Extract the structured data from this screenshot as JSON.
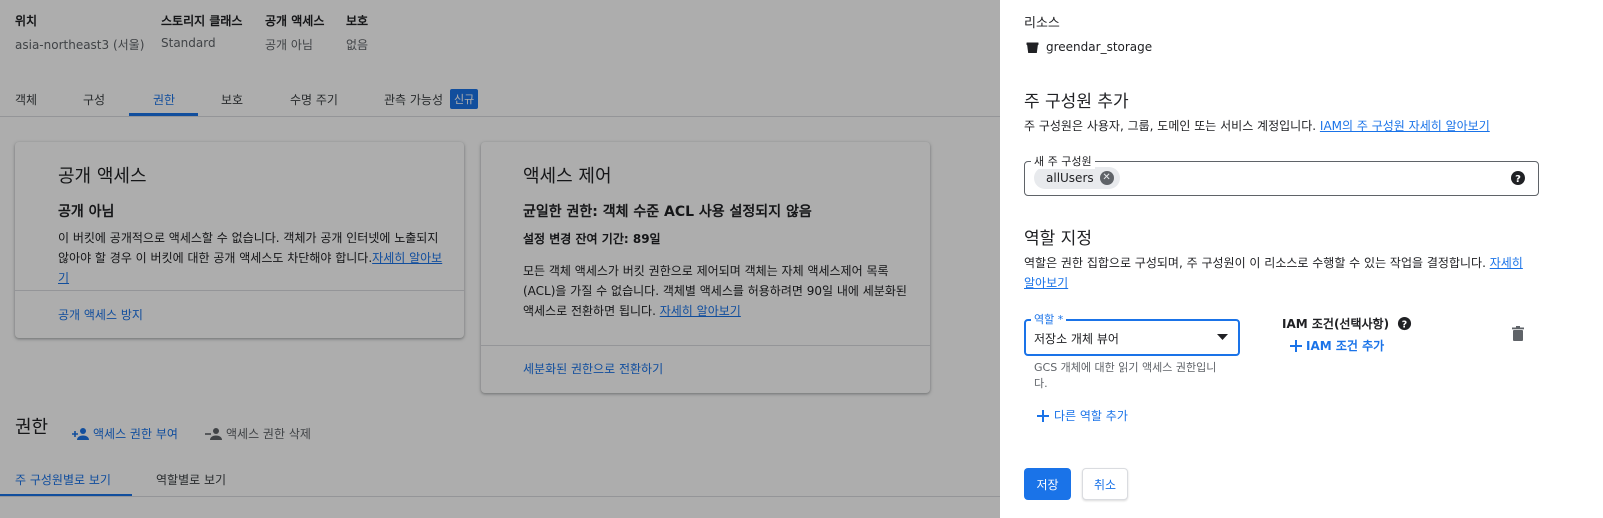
{
  "bucket_info": {
    "location_label": "위치",
    "location_value": "asia-northeast3 (서울)",
    "storage_class_label": "스토리지 클래스",
    "storage_class_value": "Standard",
    "public_access_label": "공개 액세스",
    "public_access_value": "공개 아님",
    "protection_label": "보호",
    "protection_value": "없음"
  },
  "tabs": [
    {
      "label": "객체"
    },
    {
      "label": "구성"
    },
    {
      "label": "권한"
    },
    {
      "label": "보호"
    },
    {
      "label": "수명 주기"
    },
    {
      "label": "관측 가능성",
      "badge": "신규"
    }
  ],
  "public_access_card": {
    "title": "공개 액세스",
    "status": "공개 아님",
    "description": "이 버킷에 공개적으로 액세스할 수 없습니다. 객체가 공개 인터넷에 노출되지 않아야 할 경우 이 버킷에 대한 공개 액세스도 차단해야 합니다.",
    "learn_more": "자세히 알아보기",
    "action": "공개 액세스 방지"
  },
  "access_control_card": {
    "title": "액세스 제어",
    "status": "균일한 권한: 객체 수준 ACL 사용 설정되지 않음",
    "remaining_label": "설정 변경 잔여 기간:",
    "remaining_value": "89일",
    "description": "모든 객체 액세스가 버킷 권한으로 제어되며 객체는 자체 액세스제어 목록(ACL)을 가질 수 없습니다. 객체별 액세스를 허용하려면 90일 내에 세분화된 액세스로 전환하면 됩니다.",
    "learn_more": "자세히 알아보기",
    "action": "세분화된 권한으로 전환하기"
  },
  "permissions": {
    "title": "권한",
    "grant_label": "액세스 권한 부여",
    "remove_label": "액세스 권한 삭제",
    "view_by_principal": "주 구성원별로 보기",
    "view_by_role": "역할별로 보기"
  },
  "panel": {
    "resource_label": "리소스",
    "resource_name": "greendar_storage",
    "add_principal_title": "주 구성원 추가",
    "add_principal_desc": "주 구성원은 사용자, 그룹, 도메인 또는 서비스 계정입니다.",
    "add_principal_link": "IAM의 주 구성원 자세히 알아보기",
    "new_principal_label": "새 주 구성원",
    "principal_chip": "allUsers",
    "assign_role_title": "역할 지정",
    "assign_role_desc": "역할은 권한 집합으로 구성되며, 주 구성원이 이 리소스로 수행할 수 있는 작업을 결정합니다.",
    "assign_role_link_1": "자세히",
    "assign_role_link_2": "알아보기",
    "role_label": "역할 *",
    "role_value": "저장소 개체 뷰어",
    "role_hint_1": "GCS 개체에 대한 읽기 액세스 권한입니",
    "role_hint_2": "다.",
    "iam_condition_label": "IAM 조건(선택사항)",
    "add_iam_condition": "IAM 조건 추가",
    "add_role": "다른 역할 추가",
    "save": "저장",
    "cancel": "취소"
  }
}
